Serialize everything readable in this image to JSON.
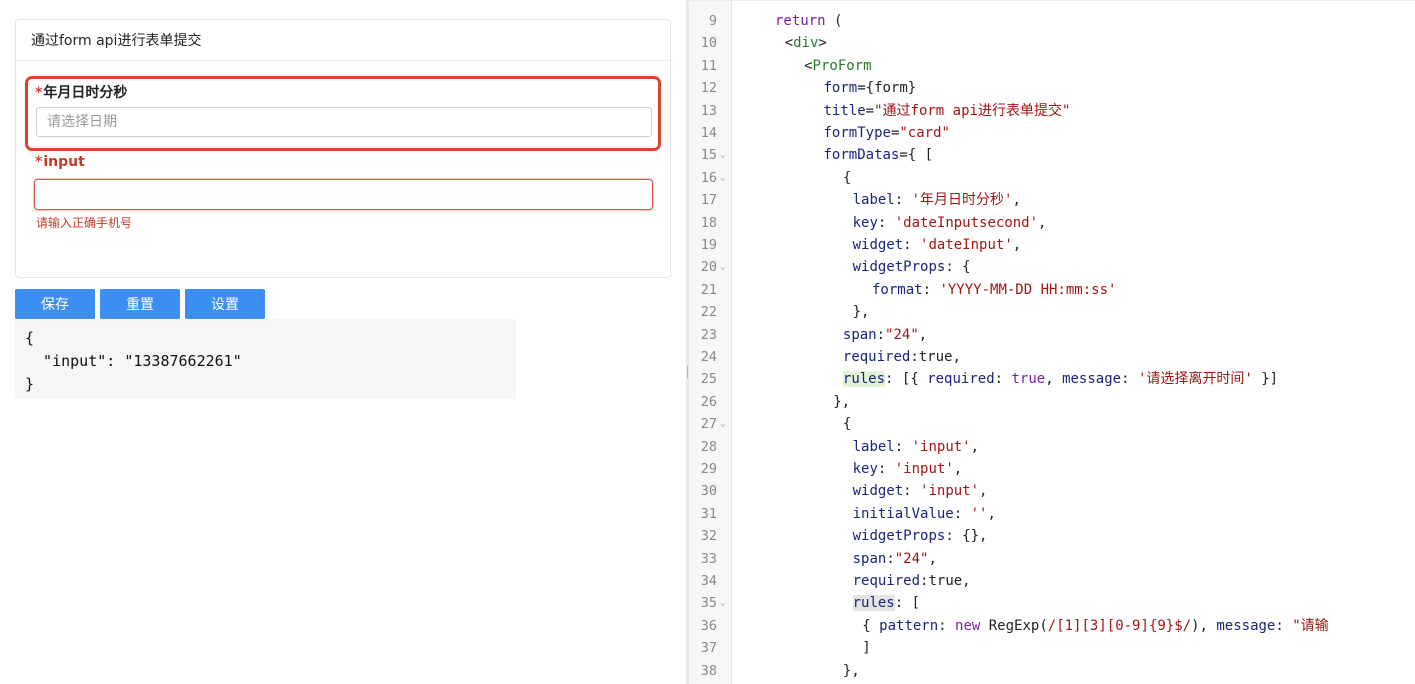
{
  "form": {
    "card_title": "通过form api进行表单提交",
    "fields": [
      {
        "label": "年月日时分秒",
        "required_mark": "*",
        "placeholder": "请选择日期"
      },
      {
        "label": "input",
        "required_mark": "*",
        "value": "",
        "error": "请输入正确手机号"
      }
    ],
    "buttons": {
      "save": "保存",
      "reset": "重置",
      "settings": "设置"
    },
    "output_lines": [
      "{",
      "  \"input\": \"13387662261\"",
      "}"
    ]
  },
  "colors": {
    "primary_button": "#3c8ef0",
    "error": "#d9432f",
    "string": "#a31515",
    "keyword": "#7b1fa2"
  },
  "editor": {
    "lines": [
      {
        "n": "9",
        "fold": false,
        "indent": 0,
        "parts": [
          [
            "kw",
            "return"
          ],
          [
            "plain",
            " ("
          ]
        ]
      },
      {
        "n": "10",
        "fold": false,
        "indent": 1,
        "parts": [
          [
            "plain",
            "<"
          ],
          [
            "tag",
            "div"
          ],
          [
            "plain",
            ">"
          ]
        ]
      },
      {
        "n": "11",
        "fold": false,
        "indent": 3,
        "parts": [
          [
            "plain",
            "<"
          ],
          [
            "tag",
            "ProForm"
          ]
        ]
      },
      {
        "n": "12",
        "fold": false,
        "indent": 5,
        "parts": [
          [
            "attr",
            "form"
          ],
          [
            "plain",
            "={form}"
          ]
        ]
      },
      {
        "n": "13",
        "fold": false,
        "indent": 5,
        "parts": [
          [
            "attr",
            "title"
          ],
          [
            "plain",
            "="
          ],
          [
            "str",
            "\"通过form api进行表单提交\""
          ]
        ]
      },
      {
        "n": "14",
        "fold": false,
        "indent": 5,
        "parts": [
          [
            "attr",
            "formType"
          ],
          [
            "plain",
            "="
          ],
          [
            "str",
            "\"card\""
          ]
        ]
      },
      {
        "n": "15",
        "fold": true,
        "indent": 5,
        "parts": [
          [
            "attr",
            "formDatas"
          ],
          [
            "plain",
            "={ ["
          ]
        ]
      },
      {
        "n": "16",
        "fold": true,
        "indent": 7,
        "parts": [
          [
            "plain",
            "{"
          ]
        ]
      },
      {
        "n": "17",
        "fold": false,
        "indent": 8,
        "parts": [
          [
            "attr",
            "label"
          ],
          [
            "plain",
            ": "
          ],
          [
            "str",
            "'年月日时分秒'"
          ],
          [
            "plain",
            ","
          ]
        ]
      },
      {
        "n": "18",
        "fold": false,
        "indent": 8,
        "parts": [
          [
            "attr",
            "key"
          ],
          [
            "plain",
            ": "
          ],
          [
            "str",
            "'dateInputsecond'"
          ],
          [
            "plain",
            ","
          ]
        ]
      },
      {
        "n": "19",
        "fold": false,
        "indent": 8,
        "parts": [
          [
            "attr",
            "widget"
          ],
          [
            "plain",
            ": "
          ],
          [
            "str",
            "'dateInput'"
          ],
          [
            "plain",
            ","
          ]
        ]
      },
      {
        "n": "20",
        "fold": true,
        "indent": 8,
        "parts": [
          [
            "attr",
            "widgetProps"
          ],
          [
            "plain",
            ": {"
          ]
        ]
      },
      {
        "n": "21",
        "fold": false,
        "indent": 10,
        "parts": [
          [
            "attr",
            "format"
          ],
          [
            "plain",
            ": "
          ],
          [
            "str",
            "'YYYY-MM-DD HH:mm:ss'"
          ]
        ]
      },
      {
        "n": "22",
        "fold": false,
        "indent": 8,
        "parts": [
          [
            "plain",
            "},"
          ]
        ]
      },
      {
        "n": "23",
        "fold": false,
        "indent": 7,
        "parts": [
          [
            "attr",
            "span"
          ],
          [
            "plain",
            ":"
          ],
          [
            "str",
            "\"24\""
          ],
          [
            "plain",
            ","
          ]
        ]
      },
      {
        "n": "24",
        "fold": false,
        "indent": 7,
        "parts": [
          [
            "attr",
            "required"
          ],
          [
            "plain",
            ":true,"
          ]
        ]
      },
      {
        "n": "25",
        "fold": false,
        "indent": 7,
        "parts": [
          [
            "attr hl-green",
            "rules"
          ],
          [
            "plain",
            ": [{ "
          ],
          [
            "attr",
            "required"
          ],
          [
            "plain",
            ": "
          ],
          [
            "kw",
            "true"
          ],
          [
            "plain",
            ", "
          ],
          [
            "attr",
            "message"
          ],
          [
            "plain",
            ": "
          ],
          [
            "str",
            "'请选择离开时间'"
          ],
          [
            "plain",
            " }]"
          ]
        ]
      },
      {
        "n": "26",
        "fold": false,
        "indent": 6,
        "parts": [
          [
            "plain",
            "},"
          ]
        ]
      },
      {
        "n": "27",
        "fold": true,
        "indent": 7,
        "parts": [
          [
            "plain",
            "{"
          ]
        ]
      },
      {
        "n": "28",
        "fold": false,
        "indent": 8,
        "parts": [
          [
            "attr",
            "label"
          ],
          [
            "plain",
            ": "
          ],
          [
            "str",
            "'input'"
          ],
          [
            "plain",
            ","
          ]
        ]
      },
      {
        "n": "29",
        "fold": false,
        "indent": 8,
        "parts": [
          [
            "attr",
            "key"
          ],
          [
            "plain",
            ": "
          ],
          [
            "str",
            "'input'"
          ],
          [
            "plain",
            ","
          ]
        ]
      },
      {
        "n": "30",
        "fold": false,
        "indent": 8,
        "parts": [
          [
            "attr",
            "widget"
          ],
          [
            "plain",
            ": "
          ],
          [
            "str",
            "'input'"
          ],
          [
            "plain",
            ","
          ]
        ]
      },
      {
        "n": "31",
        "fold": false,
        "indent": 8,
        "parts": [
          [
            "attr",
            "initialValue"
          ],
          [
            "plain",
            ": "
          ],
          [
            "str",
            "''"
          ],
          [
            "plain",
            ","
          ]
        ]
      },
      {
        "n": "32",
        "fold": false,
        "indent": 8,
        "parts": [
          [
            "attr",
            "widgetProps"
          ],
          [
            "plain",
            ": {},"
          ]
        ]
      },
      {
        "n": "33",
        "fold": false,
        "indent": 8,
        "parts": [
          [
            "attr",
            "span"
          ],
          [
            "plain",
            ":"
          ],
          [
            "str",
            "\"24\""
          ],
          [
            "plain",
            ","
          ]
        ]
      },
      {
        "n": "34",
        "fold": false,
        "indent": 8,
        "parts": [
          [
            "attr",
            "required"
          ],
          [
            "plain",
            ":true,"
          ]
        ]
      },
      {
        "n": "35",
        "fold": true,
        "indent": 8,
        "parts": [
          [
            "attr hl-gray",
            "rules"
          ],
          [
            "plain",
            ": ["
          ]
        ]
      },
      {
        "n": "36",
        "fold": false,
        "indent": 9,
        "parts": [
          [
            "plain",
            "{ "
          ],
          [
            "attr",
            "pattern"
          ],
          [
            "plain",
            ": "
          ],
          [
            "kw",
            "new"
          ],
          [
            "plain",
            " RegExp("
          ],
          [
            "str",
            "/[1][3][0-9]{9}$/"
          ],
          [
            "plain",
            "), "
          ],
          [
            "attr",
            "message"
          ],
          [
            "plain",
            ": "
          ],
          [
            "str",
            "\"请输"
          ]
        ]
      },
      {
        "n": "37",
        "fold": false,
        "indent": 9,
        "parts": [
          [
            "plain",
            "]"
          ]
        ]
      },
      {
        "n": "38",
        "fold": false,
        "indent": 7,
        "parts": [
          [
            "plain",
            "},"
          ]
        ]
      }
    ]
  }
}
